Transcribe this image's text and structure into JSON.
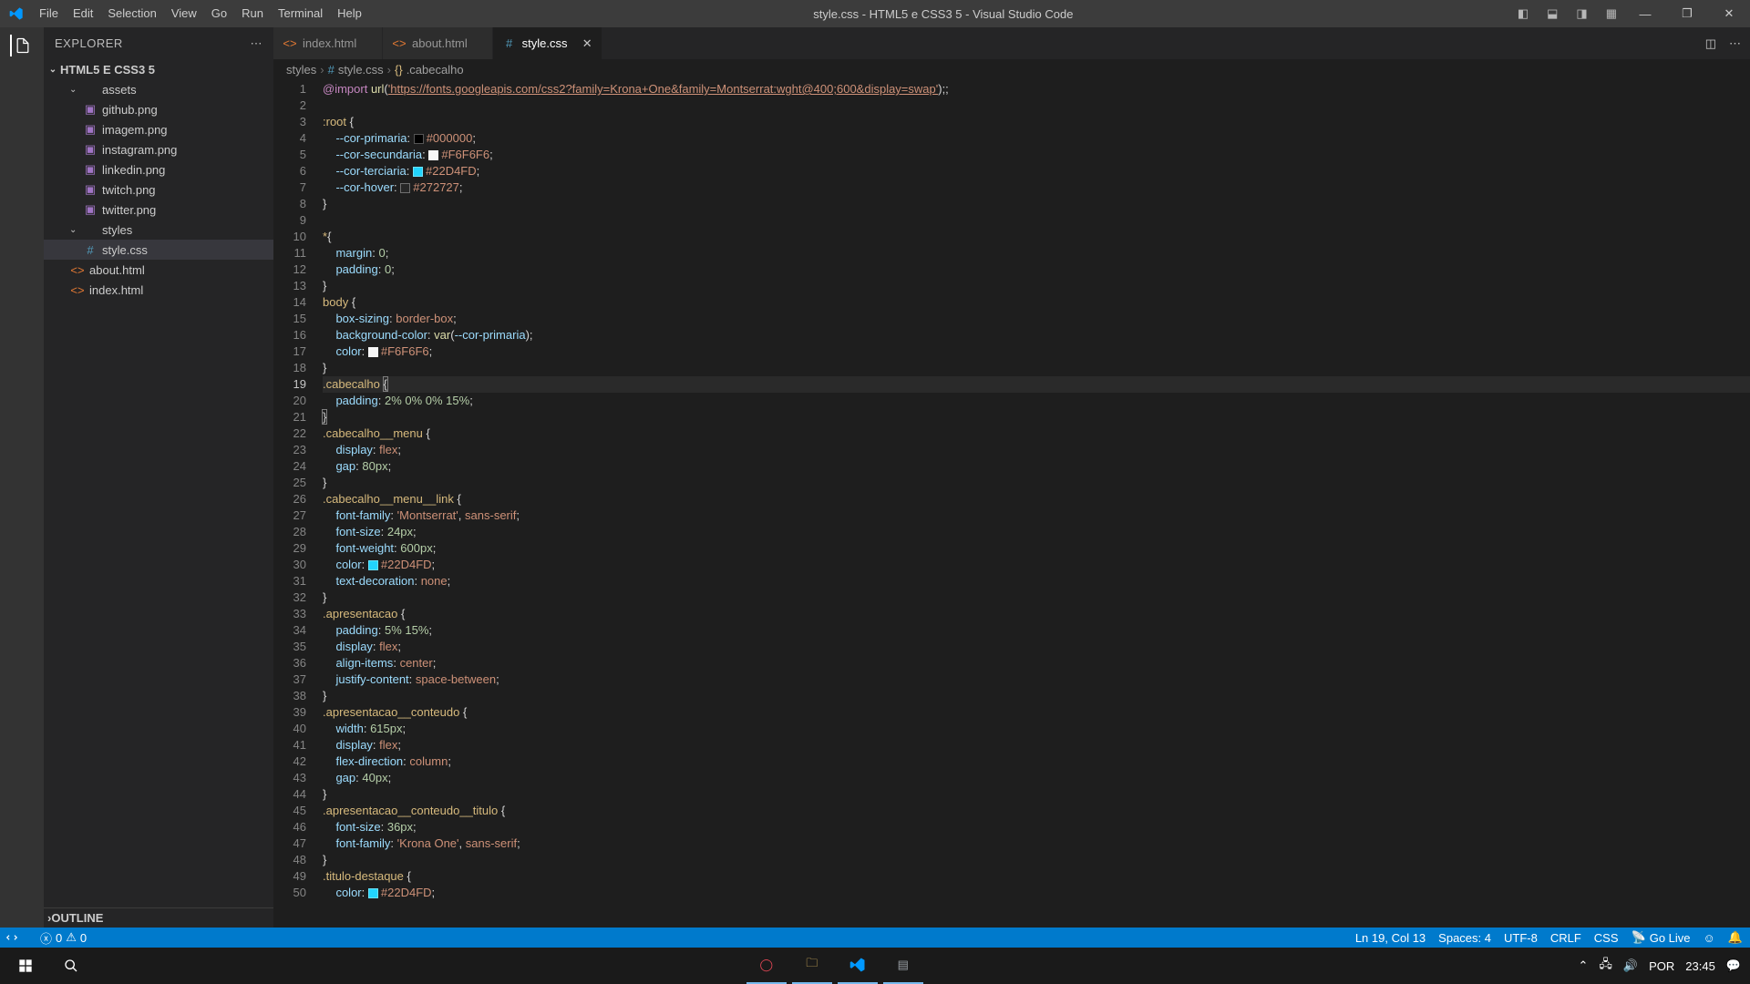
{
  "window": {
    "title": "style.css - HTML5 e CSS3 5 - Visual Studio Code"
  },
  "menubar": [
    "File",
    "Edit",
    "Selection",
    "View",
    "Go",
    "Run",
    "Terminal",
    "Help"
  ],
  "sidebar": {
    "title": "EXPLORER",
    "project": "HTML5 E CSS3 5",
    "outline": "OUTLINE",
    "tree": [
      {
        "type": "folder",
        "open": true,
        "label": "assets",
        "indent": 0
      },
      {
        "type": "img",
        "label": "github.png",
        "indent": 1
      },
      {
        "type": "img",
        "label": "imagem.png",
        "indent": 1
      },
      {
        "type": "img",
        "label": "instagram.png",
        "indent": 1
      },
      {
        "type": "img",
        "label": "linkedin.png",
        "indent": 1
      },
      {
        "type": "img",
        "label": "twitch.png",
        "indent": 1
      },
      {
        "type": "img",
        "label": "twitter.png",
        "indent": 1
      },
      {
        "type": "folder",
        "open": true,
        "label": "styles",
        "indent": 0
      },
      {
        "type": "css",
        "label": "style.css",
        "indent": 1,
        "selected": true
      },
      {
        "type": "html",
        "label": "about.html",
        "indent": 0
      },
      {
        "type": "html",
        "label": "index.html",
        "indent": 0
      }
    ]
  },
  "tabs": [
    {
      "label": "index.html",
      "type": "html",
      "active": false
    },
    {
      "label": "about.html",
      "type": "html",
      "active": false
    },
    {
      "label": "style.css",
      "type": "css",
      "active": true
    }
  ],
  "breadcrumb": {
    "a": "styles",
    "b": "style.css",
    "c": ".cabecalho"
  },
  "editor": {
    "current_line": 19,
    "import_url": "'https://fonts.googleapis.com/css2?family=Krona+One&family=Montserrat:wght@400;600&display=swap'",
    "colors": {
      "primaria": "#000000",
      "secundaria": "#F6F6F6",
      "terciaria": "#22D4FD",
      "hover": "#272727",
      "body_color": "#F6F6F6",
      "link_color": "#22D4FD"
    }
  },
  "status": {
    "errors": "0",
    "warnings": "0",
    "cursor": "Ln 19, Col 13",
    "spaces": "Spaces: 4",
    "encoding": "UTF-8",
    "eol": "CRLF",
    "lang": "CSS",
    "golive": "Go Live",
    "port": ""
  },
  "taskbar": {
    "lang": "POR",
    "time": "23:45"
  }
}
